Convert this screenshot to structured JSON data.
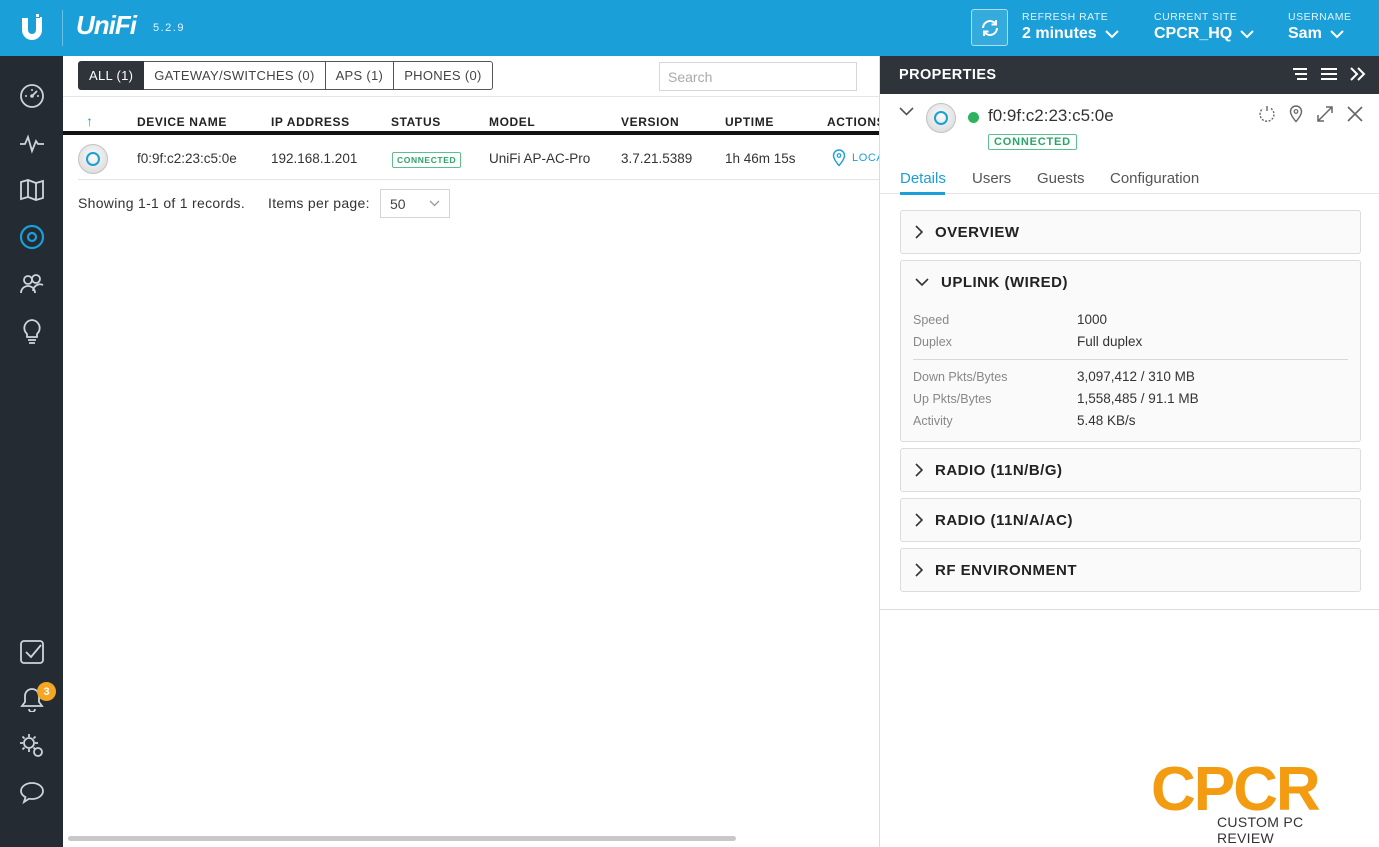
{
  "topbar": {
    "brand": "UniFi",
    "version": "5.2.9",
    "refresh_rate": {
      "label": "REFRESH RATE",
      "value": "2 minutes"
    },
    "current_site": {
      "label": "CURRENT SITE",
      "value": "CPCR_HQ"
    },
    "username": {
      "label": "USERNAME",
      "value": "Sam"
    }
  },
  "sidebar": {
    "items": [
      {
        "name": "dashboard-icon"
      },
      {
        "name": "statistics-icon"
      },
      {
        "name": "map-icon"
      },
      {
        "name": "devices-icon"
      },
      {
        "name": "clients-icon"
      },
      {
        "name": "insights-icon"
      },
      {
        "name": "events-icon"
      },
      {
        "name": "alerts-icon"
      },
      {
        "name": "settings-icon"
      },
      {
        "name": "chat-icon"
      }
    ],
    "alert_count": "3"
  },
  "filters": {
    "all": "ALL (1)",
    "gateway": "GATEWAY/SWITCHES (0)",
    "aps": "APS (1)",
    "phones": "PHONES (0)"
  },
  "search": {
    "placeholder": "Search"
  },
  "table": {
    "sort_arrow": "↑",
    "columns": [
      "DEVICE NAME",
      "IP ADDRESS",
      "STATUS",
      "MODEL",
      "VERSION",
      "UPTIME",
      "ACTIONS"
    ],
    "rows": [
      {
        "device_name": "f0:9f:c2:23:c5:0e",
        "ip": "192.168.1.201",
        "status": "CONNECTED",
        "model": "UniFi AP-AC-Pro",
        "version": "3.7.21.5389",
        "uptime": "1h 46m 15s",
        "action": "LOCATE"
      }
    ]
  },
  "pagination": {
    "records": "Showing 1-1 of 1 records.",
    "items_per_page_label": "Items per page:",
    "items_per_page_value": "50"
  },
  "panel": {
    "title": "PROPERTIES",
    "device_name": "f0:9f:c2:23:c5:0e",
    "device_status": "CONNECTED",
    "tabs": [
      "Details",
      "Users",
      "Guests",
      "Configuration"
    ],
    "sections": {
      "overview": "OVERVIEW",
      "uplink": "UPLINK (WIRED)",
      "radio_ng": "RADIO (11N/B/G)",
      "radio_na": "RADIO (11N/A/AC)",
      "rf": "RF ENVIRONMENT"
    },
    "uplink": {
      "speed_label": "Speed",
      "speed_value": "1000",
      "duplex_label": "Duplex",
      "duplex_value": "Full duplex",
      "down_label": "Down Pkts/Bytes",
      "down_value": "3,097,412 / 310 MB",
      "up_label": "Up Pkts/Bytes",
      "up_value": "1,558,485 / 91.1 MB",
      "activity_label": "Activity",
      "activity_value": "5.48 KB/s"
    }
  },
  "watermark": {
    "big": "CPCR",
    "small": "CUSTOM PC REVIEW"
  },
  "colors": {
    "accent": "#1a9fd9",
    "sidebar": "#252b32",
    "connected": "#2aa56a",
    "badge": "#f5a623"
  }
}
